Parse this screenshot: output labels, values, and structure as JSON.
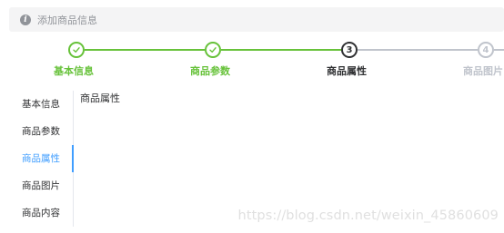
{
  "alert": {
    "icon": "info-icon",
    "glyph": "i",
    "text": "添加商品信息"
  },
  "steps": {
    "active_index": 2,
    "items": [
      {
        "title": "基本信息",
        "status": "success",
        "icon": "check-icon"
      },
      {
        "title": "商品参数",
        "status": "success",
        "icon": "check-icon"
      },
      {
        "title": "商品属性",
        "status": "process",
        "number": "3"
      },
      {
        "title": "商品图片",
        "status": "wait",
        "number": "4"
      }
    ]
  },
  "tabs": {
    "active_index": 2,
    "items": [
      {
        "label": "基本信息"
      },
      {
        "label": "商品参数"
      },
      {
        "label": "商品属性"
      },
      {
        "label": "商品图片"
      },
      {
        "label": "商品内容"
      }
    ]
  },
  "content": {
    "text": "商品属性"
  },
  "watermark": "https://blog.csdn.net/weixin_45860609",
  "colors": {
    "success": "#67c23a",
    "process": "#303133",
    "wait": "#c0c4cc",
    "tab_active": "#409eff",
    "alert_bg": "#f4f4f5",
    "alert_text": "#909399"
  }
}
